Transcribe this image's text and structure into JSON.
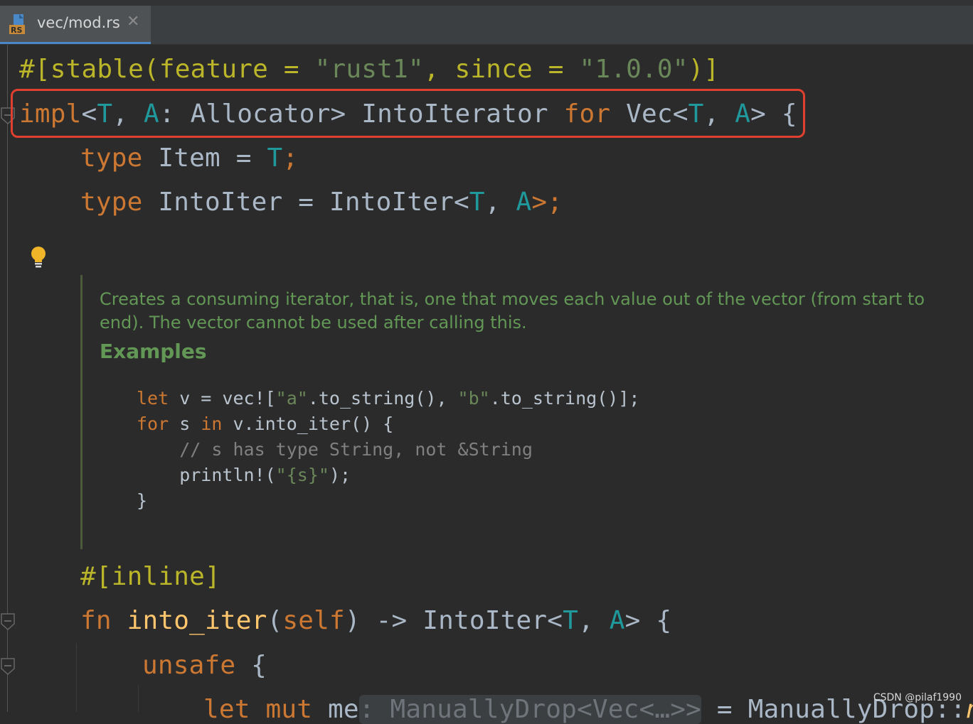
{
  "tab": {
    "icon_badge": "RS",
    "label": "vec/mod.rs",
    "close_glyph": "✕"
  },
  "code": {
    "l1": {
      "a": "#[stable(feature = ",
      "b": "\"rust1\"",
      "c": ", since = ",
      "d": "\"1.0.0\"",
      "e": ")]"
    },
    "l2": {
      "kw1": "impl",
      "p1": "<",
      "t1": "T",
      "p2": ", ",
      "t2": "A",
      "p3": ": Allocator> IntoIterator ",
      "kw2": "for",
      "p4": " Vec<",
      "t3": "T",
      "p5": ", ",
      "t4": "A",
      "p6": "> {"
    },
    "l3": {
      "kw": "type",
      "p1": " Item = ",
      "t1": "T",
      "p2": ";"
    },
    "l4": {
      "kw": "type",
      "p1": " IntoIter = IntoIter<",
      "t1": "T",
      "p2": ", ",
      "t2": "A",
      "p3": ">;"
    },
    "l5": {
      "attr": "#[inline]"
    },
    "l6": {
      "kw": "fn",
      "fn": " into_iter",
      "p1": "(",
      "self": "self",
      "p2": ") -> IntoIter<",
      "t1": "T",
      "p3": ", ",
      "t2": "A",
      "p4": "> {"
    },
    "l7": {
      "kw": "unsafe",
      "p1": " {"
    },
    "l8": {
      "kw": "let mut",
      "p1": " me",
      "hint": ": ManuallyDrop<Vec<…>>",
      "p2": " = ManuallyDrop::",
      "fn": "ne"
    }
  },
  "doc": {
    "text": "Creates a consuming iterator, that is, one that moves each value out of the vector (from start to end). The vector cannot be used after calling this.",
    "heading": "Examples",
    "c1": {
      "kw": "let",
      "a": " v = vec![",
      "s1": "\"a\"",
      "b": ".to_string(), ",
      "s2": "\"b\"",
      "c": ".to_string()];"
    },
    "c2": {
      "kw1": "for",
      "a": " s ",
      "kw2": "in",
      "b": " v.into_iter() {"
    },
    "c3": {
      "comment": "    // s has type String, not &String"
    },
    "c4": {
      "a": "    println!(",
      "s": "\"{s}\"",
      "b": ");"
    },
    "c5": {
      "a": "}"
    }
  },
  "watermark": "CSDN @pilaf1990",
  "colors": {
    "background": "#2b2b2b",
    "keyword": "#cc7832",
    "string": "#6a8759",
    "type_param": "#20999d",
    "function": "#ffc66d",
    "highlight_box": "#e0402f",
    "doc_text": "#629755"
  }
}
